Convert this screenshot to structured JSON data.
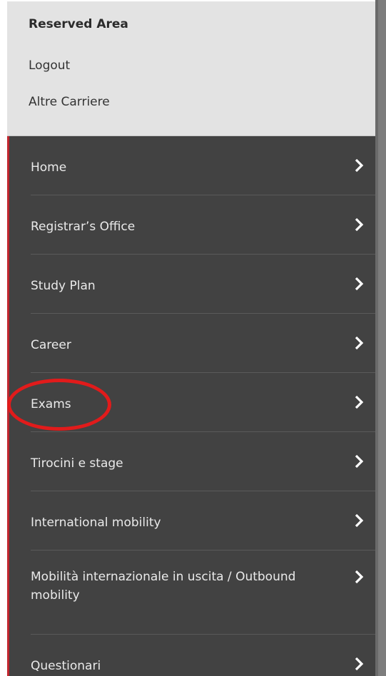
{
  "reserved_area": {
    "title": "Reserved Area",
    "logout_label": "Logout",
    "altre_carriere_label": "Altre Carriere"
  },
  "menu": {
    "items": [
      {
        "label": "Home",
        "icon": "chevron-right-icon"
      },
      {
        "label": "Registrar’s Office",
        "icon": "chevron-right-icon"
      },
      {
        "label": "Study Plan",
        "icon": "chevron-right-icon"
      },
      {
        "label": "Career",
        "icon": "chevron-right-icon"
      },
      {
        "label": "Exams",
        "icon": "chevron-right-icon"
      },
      {
        "label": "Tirocini e stage",
        "icon": "chevron-right-icon"
      },
      {
        "label": "International mobility",
        "icon": "chevron-right-icon"
      },
      {
        "label": "Mobilità internazionale in uscita / Outbound mobility",
        "icon": "chevron-right-icon"
      },
      {
        "label": "Questionari",
        "icon": "chevron-right-icon"
      }
    ]
  },
  "colors": {
    "menu_background": "#424242",
    "reserved_background": "#e3e3e3",
    "accent_border": "#c0262f",
    "highlight_ring": "#e11b1b"
  }
}
